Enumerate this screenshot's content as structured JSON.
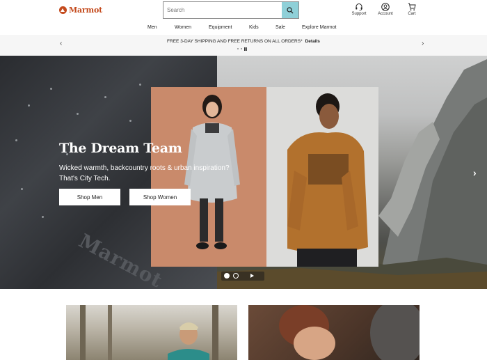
{
  "brand": {
    "name": "Marmot",
    "color": "#c44a1c"
  },
  "search": {
    "placeholder": "Search",
    "icon": "search-icon",
    "button_color": "#8fd0d8"
  },
  "utility": [
    {
      "label": "Support",
      "icon": "headset-icon"
    },
    {
      "label": "Account",
      "icon": "user-icon"
    },
    {
      "label": "Cart",
      "icon": "cart-icon"
    }
  ],
  "nav": [
    "Men",
    "Women",
    "Equipment",
    "Kids",
    "Sale",
    "Explore Marmot"
  ],
  "promo": {
    "message": "FREE 3-DAY SHIPPING AND FREE RETURNS ON ALL ORDERS*",
    "link": "Details",
    "prev_icon": "chevron-left-icon",
    "next_icon": "chevron-right-icon"
  },
  "hero": {
    "title": "The Dream Team",
    "subtitle_line1": "Wicked warmth, backcountry roots & urban inspiration?",
    "subtitle_line2": "That's City Tech.",
    "buttons": {
      "men": "Shop Men",
      "women": "Shop Women"
    },
    "next_icon": "chevron-right-icon"
  }
}
